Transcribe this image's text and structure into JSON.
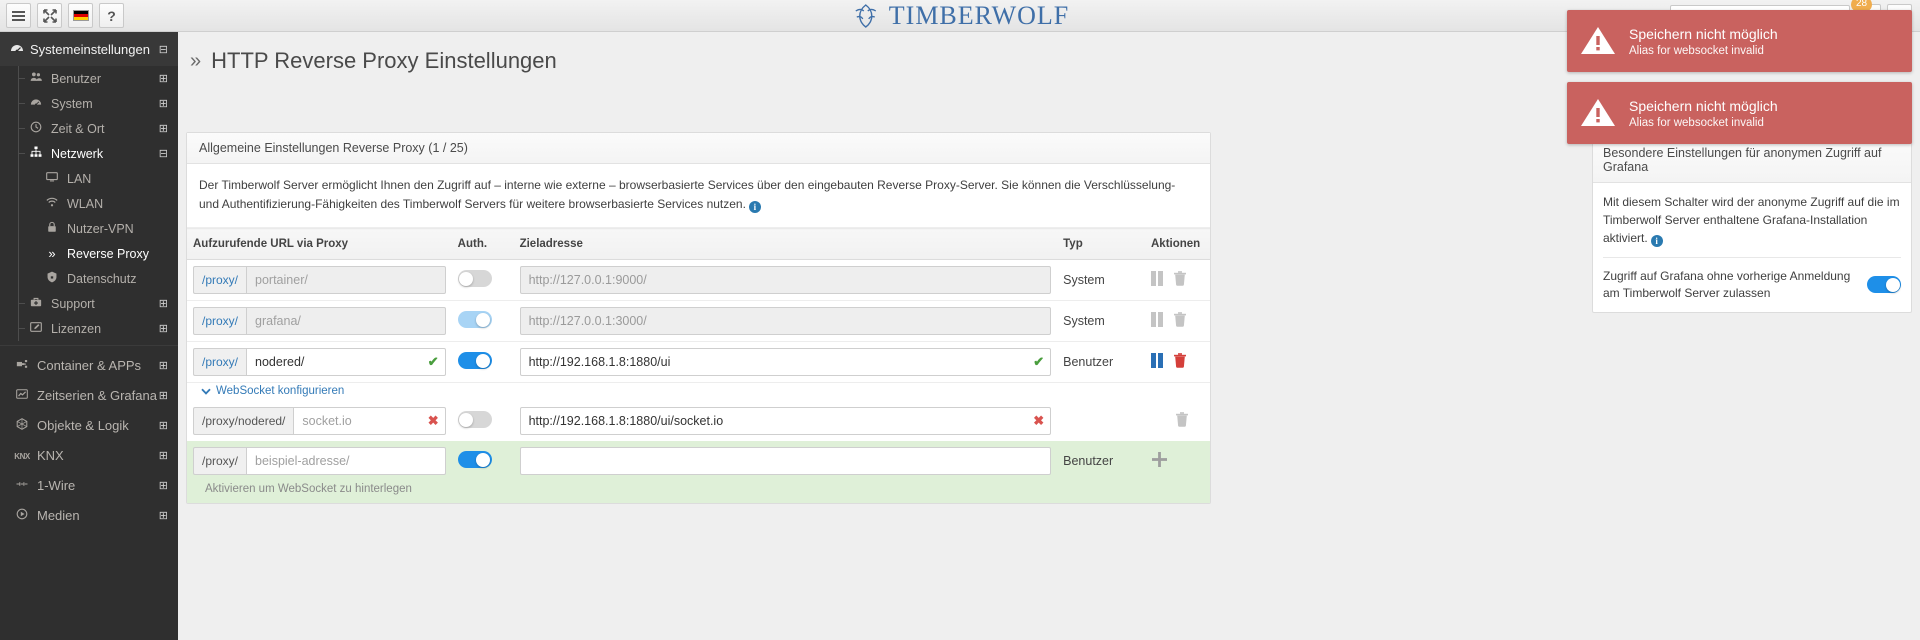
{
  "topbar": {
    "menu_icon": "hamburger-icon",
    "fullscreen_icon": "expand-arrows-icon",
    "language_icon": "german-flag-icon",
    "help_label": "?",
    "brand": "TIMBERWOLF",
    "search_value": "",
    "search_placeholder": "",
    "notification_count": "28"
  },
  "sidebar": {
    "header": {
      "label": "Systemeinstellungen",
      "icon": "dashboard-icon",
      "collapse": "⊟"
    },
    "items": [
      {
        "label": "Benutzer",
        "icon": "users-icon",
        "level": 1,
        "expand": "⊞",
        "active": false
      },
      {
        "label": "System",
        "icon": "dashboard-icon",
        "level": 1,
        "expand": "⊞",
        "active": false
      },
      {
        "label": "Zeit & Ort",
        "icon": "clock-icon",
        "level": 1,
        "expand": "⊞",
        "active": false
      },
      {
        "label": "Netzwerk",
        "icon": "sitemap-icon",
        "level": 1,
        "expand": "⊟",
        "active": true
      },
      {
        "label": "LAN",
        "icon": "monitor-icon",
        "level": 2,
        "expand": "",
        "active": false
      },
      {
        "label": "WLAN",
        "icon": "wifi-icon",
        "level": 2,
        "expand": "",
        "active": false
      },
      {
        "label": "Nutzer-VPN",
        "icon": "lock-icon",
        "level": 2,
        "expand": "",
        "active": false
      },
      {
        "label": "Reverse Proxy",
        "icon": "chevrons-right-icon",
        "level": 2,
        "expand": "",
        "active": true
      },
      {
        "label": "Datenschutz",
        "icon": "shield-lock-icon",
        "level": 2,
        "expand": "",
        "active": false
      },
      {
        "label": "Support",
        "icon": "toolbox-icon",
        "level": 1,
        "expand": "⊞",
        "active": false
      },
      {
        "label": "Lizenzen",
        "icon": "edit-icon",
        "level": 1,
        "expand": "⊞",
        "active": false
      }
    ],
    "groups": [
      {
        "label": "Container & APPs",
        "icon": "plug-icon",
        "expand": "⊞"
      },
      {
        "label": "Zeitserien & Grafana",
        "icon": "chart-line-icon",
        "expand": "⊞"
      },
      {
        "label": "Objekte & Logik",
        "icon": "hexagon-icon",
        "expand": "⊞"
      },
      {
        "label": "KNX",
        "icon": "knx-icon",
        "expand": "⊞"
      },
      {
        "label": "1-Wire",
        "icon": "onewire-icon",
        "expand": "⊞"
      },
      {
        "label": "Medien",
        "icon": "media-icon",
        "expand": "⊞"
      }
    ]
  },
  "page": {
    "chevron": "»",
    "title": "HTTP Reverse Proxy Einstellungen"
  },
  "panel": {
    "heading": "Allgemeine Einstellungen Reverse Proxy (1 / 25)",
    "description": "Der Timberwolf Server ermöglicht Ihnen den Zugriff auf – interne wie externe – browserbasierte Services über den eingebauten Reverse Proxy-Server. Sie können die Verschlüsselung- und Authentifizierung-Fähigkeiten des Timberwolf Servers für weitere browserbasierte Services nutzen.",
    "info_icon": "info-circle-icon",
    "columns": {
      "url": "Aufzurufende URL via Proxy",
      "auth": "Auth.",
      "target": "Zieladresse",
      "typ": "Typ",
      "actions": "Aktionen"
    },
    "rows": [
      {
        "prefix": "/proxy/",
        "alias": "portainer/",
        "alias_is_placeholder": true,
        "alias_valid": "",
        "auth_on": false,
        "auth_style": "off",
        "target": "http://127.0.0.1:9000/",
        "target_disabled": true,
        "target_valid": "",
        "typ": "System",
        "actions": [
          "pause-icon",
          "trash-icon"
        ],
        "action_style": "grey"
      },
      {
        "prefix": "/proxy/",
        "alias": "grafana/",
        "alias_is_placeholder": true,
        "alias_valid": "",
        "auth_on": true,
        "auth_style": "light",
        "target": "http://127.0.0.1:3000/",
        "target_disabled": true,
        "target_valid": "",
        "typ": "System",
        "actions": [
          "pause-icon",
          "trash-icon"
        ],
        "action_style": "grey"
      },
      {
        "prefix": "/proxy/",
        "alias": "nodered/",
        "alias_is_placeholder": false,
        "alias_valid": "✔",
        "auth_on": true,
        "auth_style": "on",
        "target": "http://192.168.1.8:1880/ui",
        "target_disabled": false,
        "target_valid": "✔",
        "typ": "Benutzer",
        "actions": [
          "pause-icon",
          "trash-icon"
        ],
        "action_style": "color"
      }
    ],
    "websocket": {
      "link_label": "WebSocket konfigurieren",
      "chevron_icon": "chevron-down-icon",
      "prefix": "/proxy/nodered/",
      "alias": "socket.io",
      "alias_valid": "✖",
      "auth_on": false,
      "target": "http://192.168.1.8:1880/ui/socket.io",
      "target_valid": "✖",
      "typ": "",
      "actions": [
        "trash-icon"
      ]
    },
    "new_row": {
      "prefix": "/proxy/",
      "alias_placeholder": "beispiel-adresse/",
      "alias": "",
      "auth_on": true,
      "target": "",
      "typ": "Benutzer",
      "action_icon": "plus-icon",
      "hint": "Aktivieren um WebSocket zu hinterlegen"
    }
  },
  "right_panel": {
    "heading": "Besondere Einstellungen für anonymen Zugriff auf Grafana",
    "description": "Mit diesem Schalter wird der anonyme Zugriff auf die im Timberwolf Server enthaltene Grafana-Installation aktiviert.",
    "info_icon": "info-circle-icon",
    "toggle_label": "Zugriff auf Grafana ohne vorherige Anmeldung am Timberwolf Server zulassen",
    "toggle_on": true
  },
  "toasts": [
    {
      "icon": "warning-triangle-icon",
      "title": "Speichern nicht möglich",
      "message": "Alias for websocket invalid"
    },
    {
      "icon": "warning-triangle-icon",
      "title": "Speichern nicht möglich",
      "message": "Alias for websocket invalid"
    }
  ],
  "colors": {
    "accent_blue": "#1e8fe8",
    "link_blue": "#337ab7",
    "brand": "#3f6fa8",
    "error_red": "#c9625f",
    "valid_green": "#4a9e3e",
    "invalid_red": "#d9534f",
    "new_row_green": "#dff0d8"
  }
}
